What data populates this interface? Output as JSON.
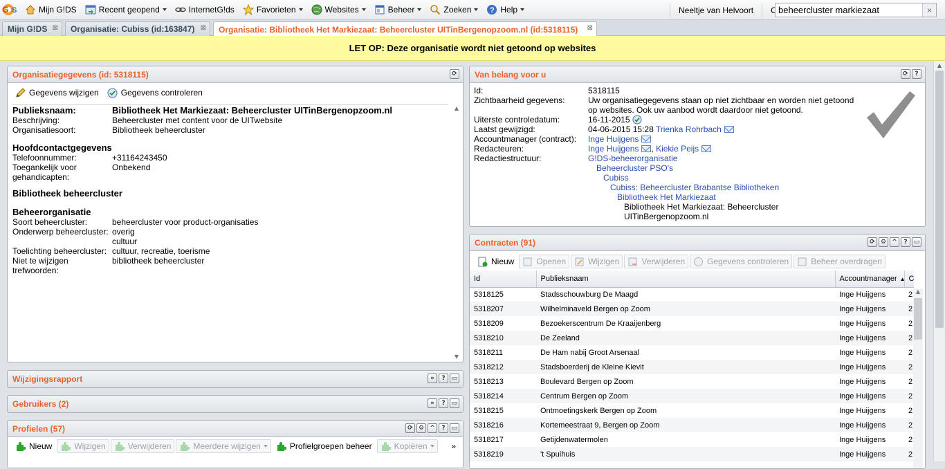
{
  "menu": {
    "items": [
      {
        "label": "Mijn G!DS",
        "icon": "home-icon",
        "caret": false
      },
      {
        "label": "Recent geopend",
        "icon": "recent-icon",
        "caret": true
      },
      {
        "label": "InternetG!ds",
        "icon": "link-chain-icon",
        "caret": false
      },
      {
        "label": "Favorieten",
        "icon": "star-icon",
        "caret": true
      },
      {
        "label": "Websites",
        "icon": "globe-icon",
        "caret": true
      },
      {
        "label": "Beheer",
        "icon": "window-icon",
        "caret": true
      },
      {
        "label": "Zoeken",
        "icon": "magnifier-icon",
        "caret": true
      },
      {
        "label": "Help",
        "icon": "help-icon",
        "caret": true
      }
    ],
    "user": "Neeltje van Helvoort",
    "org_label": "Org",
    "search_value": "beheercluster markiezaat",
    "search_clear": "×"
  },
  "tabs": [
    {
      "label": "Mijn G!DS",
      "close": "⊠"
    },
    {
      "label": "Organisatie: Cubiss (id:163847)",
      "close": "⊠"
    },
    {
      "label": "Organisatie: Bibliotheek Het Markiezaat: Beheercluster UITinBergenopzoom.nl (id:5318115)",
      "close": "⊠"
    }
  ],
  "warning": "LET OP: Deze organisatie wordt niet getoond op websites",
  "orgpanel": {
    "title": "Organisatiegegevens (id: 5318115)",
    "edit": "Gegevens wijzigen",
    "check": "Gegevens controleren",
    "name_key": "Publieksnaam:",
    "name_val": "Bibliotheek Het Markiezaat: Beheercluster UITinBergenopzoom.nl",
    "desc_key": "Beschrijving:",
    "desc_val": "Beheercluster met content voor de UITwebsite",
    "type_key": "Organisatiesoort:",
    "type_val": "Bibliotheek beheercluster",
    "contact_head": "Hoofdcontactgegevens",
    "phone_key": "Telefoonnummer:",
    "phone_val": "+31164243450",
    "access_key": "Toegankelijk voor gehandicapten:",
    "access_val": "Onbekend",
    "section2": "Bibliotheek beheercluster",
    "section3": "Beheerorganisatie",
    "sort_key": "Soort beheercluster:",
    "sort_val": "beheercluster voor product-organisaties",
    "subj_key": "Onderwerp beheercluster:",
    "subj_val1": "overig",
    "subj_val2": "cultuur",
    "note_key": "Toelichting beheercluster:",
    "note_val": "cultuur, recreatie, toerisme",
    "fixed_key": "Niet te wijzigen trefwoorden:",
    "fixed_val": "bibliotheek beheercluster"
  },
  "collapsed": [
    {
      "title": "Wijzigingsrapport"
    },
    {
      "title": "Gebruikers (2)"
    }
  ],
  "profiles": {
    "title": "Profielen (57)",
    "buttons": [
      "Nieuw",
      "Wijzigen",
      "Verwijderen",
      "Meerdere wijzigen",
      "Profielgroepen beheer",
      "Kopiëren"
    ],
    "more": "»"
  },
  "vanbelang": {
    "title": "Van belang voor u",
    "id_key": "Id:",
    "id_val": "5318115",
    "vis_key": "Zichtbaarheid gegevens:",
    "vis_val": "Uw organisatiegegevens staan op niet zichtbaar en worden niet getoond op websites. Ook uw aanbod wordt daardoor niet getoond.",
    "ctrl_key": "Uiterste controledatum:",
    "ctrl_val": "16-11-2015",
    "mod_key": "Laatst gewijzigd:",
    "mod_val": "04-06-2015 15:28",
    "mod_user": "Trienka Rohrbach",
    "acc_key": "Accountmanager (contract):",
    "acc_val": "Inge Huijgens",
    "red_key": "Redacteuren:",
    "red_val1": "Inge Huijgens",
    "red_sep": ",",
    "red_val2": "Kiekie Peijs",
    "struct_key": "Redactiestructuur:",
    "structure": [
      "G!DS-beheerorganisatie",
      "Beheercluster PSO's",
      "Cubiss",
      "Cubiss: Beheercluster Brabantse Bibliotheken",
      "Bibliotheek Het Markiezaat",
      "Bibliotheek Het Markiezaat: Beheercluster UITinBergenopzoom.nl"
    ]
  },
  "contracts": {
    "title": "Contracten (91)",
    "buttons": [
      "Nieuw",
      "Openen",
      "Wijzigen",
      "Verwijderen",
      "Gegevens controleren",
      "Beheer overdragen"
    ],
    "columns": [
      "Id",
      "Publieksnaam",
      "Accountmanager",
      "Cont"
    ],
    "rows": [
      [
        "5318125",
        "Stadsschouwburg De Maagd",
        "Inge Huijgens",
        "2"
      ],
      [
        "5318207",
        "Wilhelminaveld Bergen op Zoom",
        "Inge Huijgens",
        "2"
      ],
      [
        "5318209",
        "Bezoekerscentrum De Kraaijenberg",
        "Inge Huijgens",
        "2"
      ],
      [
        "5318210",
        "De Zeeland",
        "Inge Huijgens",
        "2"
      ],
      [
        "5318211",
        "De Ham nabij Groot Arsenaal",
        "Inge Huijgens",
        "2"
      ],
      [
        "5318212",
        "Stadsboerderij de Kleine Kievit",
        "Inge Huijgens",
        "2"
      ],
      [
        "5318213",
        "Boulevard Bergen op Zoom",
        "Inge Huijgens",
        "2"
      ],
      [
        "5318214",
        "Centrum Bergen op Zoom",
        "Inge Huijgens",
        "2"
      ],
      [
        "5318215",
        "Ontmoetingskerk Bergen op Zoom",
        "Inge Huijgens",
        "2"
      ],
      [
        "5318216",
        "Kortemeestraat 9, Bergen op Zoom",
        "Inge Huijgens",
        "2"
      ],
      [
        "5318217",
        "Getijdenwatermolen",
        "Inge Huijgens",
        "2"
      ],
      [
        "5318219",
        "'t Spuihuis",
        "Inge Huijgens",
        "2"
      ]
    ]
  },
  "colors": {
    "accent": "#e8622c",
    "link": "#2a4fb0",
    "warning_bg": "#fffaa0"
  }
}
